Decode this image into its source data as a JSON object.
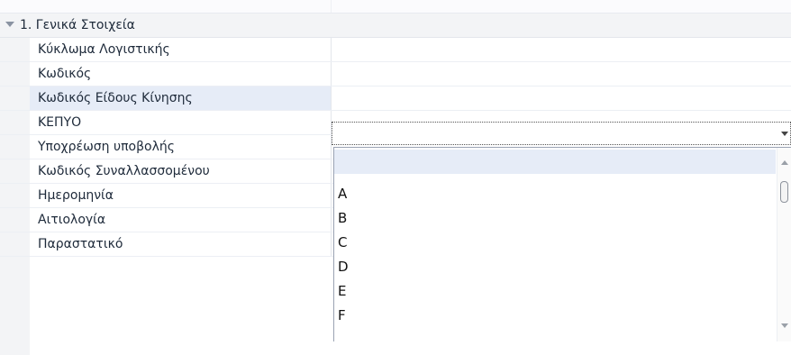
{
  "category": {
    "label": "1. Γενικά Στοιχεία"
  },
  "properties": [
    {
      "name": "Κύκλωμα Λογιστικής",
      "value": ""
    },
    {
      "name": "Κωδικός",
      "value": ""
    },
    {
      "name": "Κωδικός Είδους Κίνησης",
      "value": ""
    },
    {
      "name": "ΚΕΠΥΟ",
      "value": ""
    },
    {
      "name": "Υποχρέωση υποβολής",
      "value": ""
    },
    {
      "name": "Κωδικός Συναλλασσομένου",
      "value": ""
    },
    {
      "name": "Ημερομηνία",
      "value": ""
    },
    {
      "name": "Αιτιολογία",
      "value": ""
    },
    {
      "name": "Παραστατικό",
      "value": ""
    }
  ],
  "dropdown": {
    "options": [
      "",
      "A",
      "B",
      "C",
      "D",
      "E",
      "F"
    ],
    "highlighted_index": 0
  },
  "colors": {
    "selection": "#e6ecf7",
    "category_bg": "#f3f4f6",
    "text": "#1e2a3a"
  }
}
